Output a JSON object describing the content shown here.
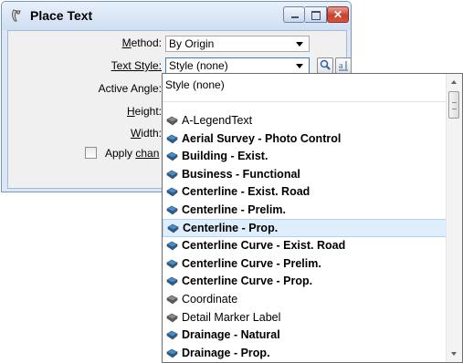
{
  "window": {
    "title": "Place Text",
    "icon": "place-text-icon",
    "controls": [
      "minimize-icon",
      "maximize-icon",
      "close-icon"
    ]
  },
  "form": {
    "method_label": "Method:",
    "method_value": "By Origin",
    "text_style_label": "Text Style:",
    "text_style_value": "Style (none)",
    "active_angle_label": "Active Angle:",
    "height_label": "Height:",
    "width_label": "Width:",
    "apply_changes_label": "Apply chan",
    "apply_changes_checked": false,
    "tool_buttons": [
      "match-text-style-icon",
      "edit-text-style-icon"
    ]
  },
  "dropdown": {
    "first_item": "Style (none)",
    "items": [
      {
        "label": "A-LegendText",
        "bold": false,
        "icon": "text-style-gray-icon",
        "selected": false
      },
      {
        "label": "Aerial Survey - Photo Control",
        "bold": true,
        "icon": "text-style-blue-icon",
        "selected": false
      },
      {
        "label": "Building - Exist.",
        "bold": true,
        "icon": "text-style-blue-icon",
        "selected": false
      },
      {
        "label": "Business - Functional",
        "bold": true,
        "icon": "text-style-blue-icon",
        "selected": false
      },
      {
        "label": "Centerline - Exist. Road",
        "bold": true,
        "icon": "text-style-blue-icon",
        "selected": false
      },
      {
        "label": "Centerline - Prelim.",
        "bold": true,
        "icon": "text-style-blue-icon",
        "selected": false
      },
      {
        "label": "Centerline - Prop.",
        "bold": true,
        "icon": "text-style-blue-icon",
        "selected": true
      },
      {
        "label": "Centerline Curve - Exist. Road",
        "bold": true,
        "icon": "text-style-blue-icon",
        "selected": false
      },
      {
        "label": "Centerline Curve - Prelim.",
        "bold": true,
        "icon": "text-style-blue-icon",
        "selected": false
      },
      {
        "label": "Centerline Curve - Prop.",
        "bold": true,
        "icon": "text-style-blue-icon",
        "selected": false
      },
      {
        "label": "Coordinate",
        "bold": false,
        "icon": "text-style-gray-icon",
        "selected": false
      },
      {
        "label": "Detail Marker Label",
        "bold": false,
        "icon": "text-style-gray-icon",
        "selected": false
      },
      {
        "label": "Drainage - Natural",
        "bold": true,
        "icon": "text-style-blue-icon",
        "selected": false
      },
      {
        "label": "Drainage - Prop.",
        "bold": true,
        "icon": "text-style-blue-icon",
        "selected": false
      }
    ]
  },
  "colors": {
    "selection_bg": "#dfeefc",
    "blue_icon": "#3d8fd6",
    "gray_icon": "#8a8a8a"
  }
}
